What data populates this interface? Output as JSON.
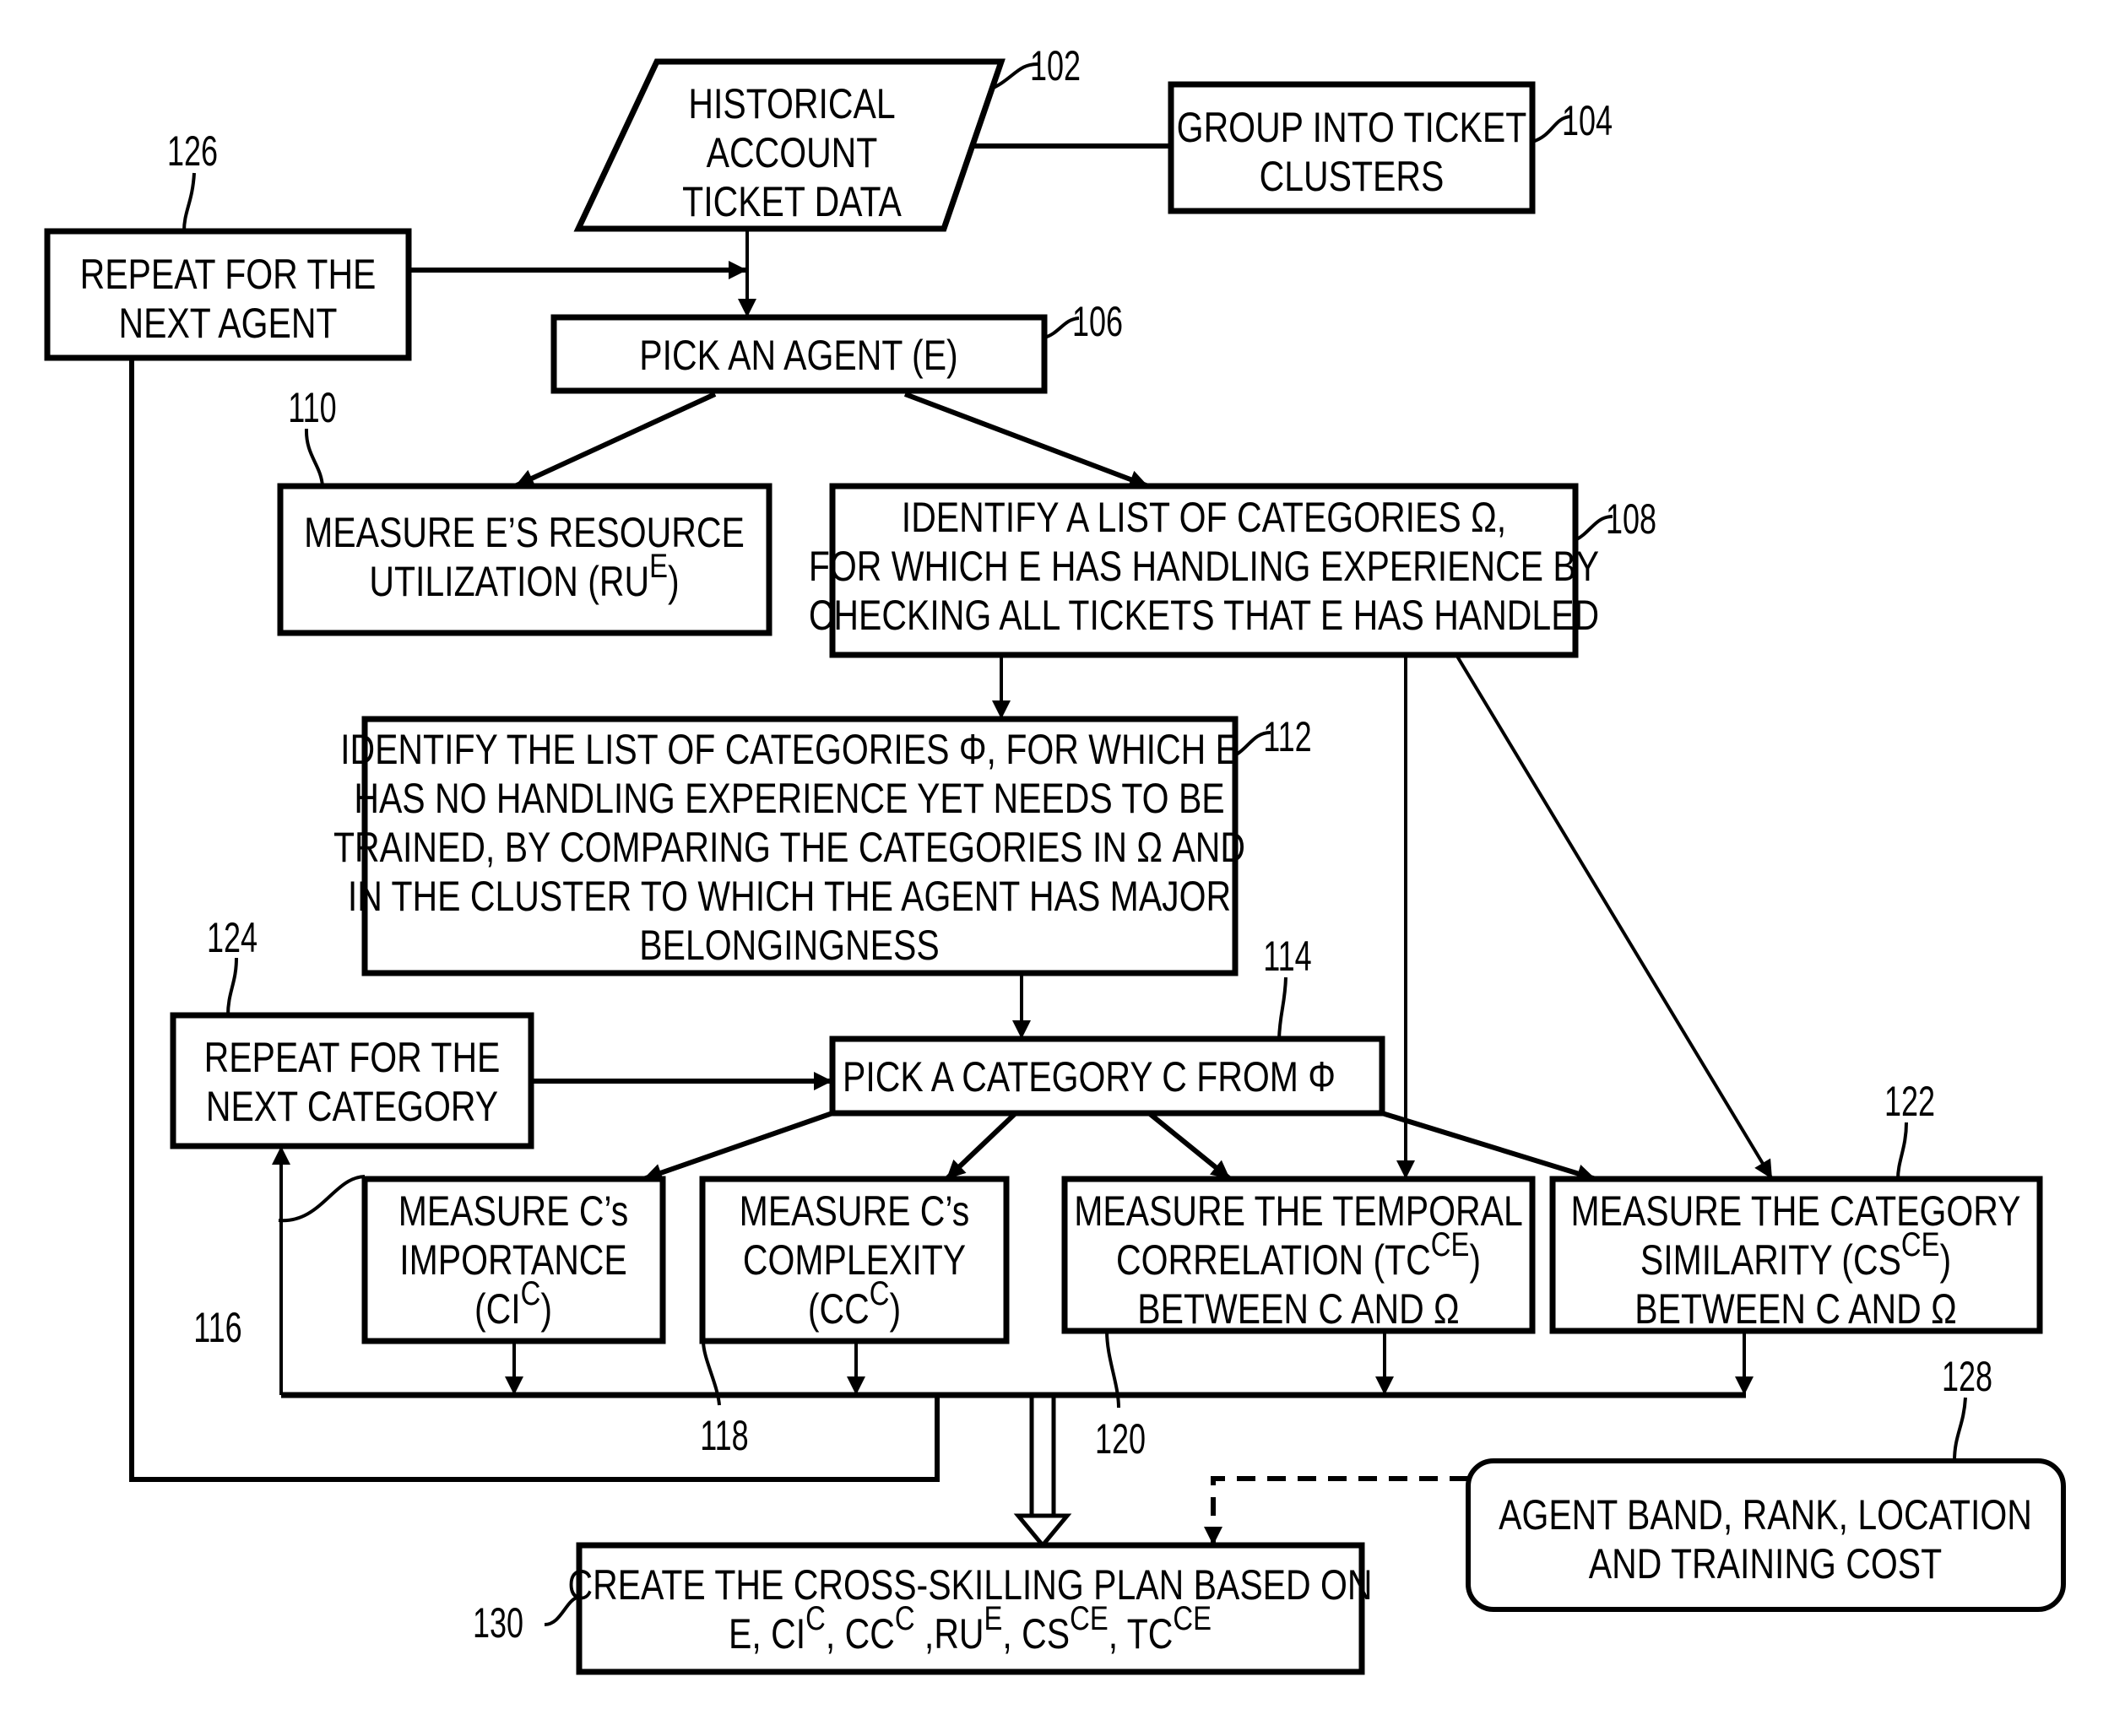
{
  "figure": {
    "type": "flowchart",
    "colors": {
      "stroke": "#000000",
      "background": "#ffffff"
    }
  },
  "nodes": {
    "n102": {
      "ref": "102",
      "shape": "parallelogram",
      "lines": [
        "HISTORICAL",
        "ACCOUNT",
        "TICKET DATA"
      ]
    },
    "n104": {
      "ref": "104",
      "shape": "rectangle",
      "lines": [
        "GROUP INTO TICKET",
        "CLUSTERS"
      ]
    },
    "n106": {
      "ref": "106",
      "shape": "rectangle",
      "lines": [
        "PICK AN AGENT (E)"
      ]
    },
    "n108": {
      "ref": "108",
      "shape": "rectangle",
      "lines": [
        "IDENTIFY A LIST OF CATEGORIES Ω,",
        "FOR WHICH E HAS HANDLING EXPERIENCE BY",
        "CHECKING ALL TICKETS THAT E HAS HANDLED"
      ]
    },
    "n110": {
      "ref": "110",
      "shape": "rectangle",
      "lines": [
        "MEASURE E’S RESOURCE",
        "UTILIZATION (RU|E|)"
      ]
    },
    "n112": {
      "ref": "112",
      "shape": "rectangle",
      "lines": [
        "IDENTIFY THE LIST OF CATEGORIES Φ, FOR WHICH E",
        "HAS NO HANDLING EXPERIENCE YET NEEDS TO BE",
        "TRAINED, BY COMPARING THE CATEGORIES IN Ω AND",
        "IN THE CLUSTER TO WHICH THE AGENT HAS MAJOR",
        "BELONGINGNESS"
      ]
    },
    "n114": {
      "ref": "114",
      "shape": "rectangle",
      "lines": [
        "PICK A CATEGORY C FROM Φ"
      ]
    },
    "n116": {
      "ref": "116",
      "shape": "rectangle",
      "lines": [
        "MEASURE C’s",
        "IMPORTANCE",
        "(CI|C|)"
      ]
    },
    "n118": {
      "ref": "118",
      "shape": "rectangle",
      "lines": [
        "MEASURE C’s",
        "COMPLEXITY",
        "(CC|C|)"
      ]
    },
    "n120": {
      "ref": "120",
      "shape": "rectangle",
      "lines": [
        "MEASURE THE TEMPORAL",
        "CORRELATION (TC|CE|)",
        "BETWEEN C AND Ω"
      ]
    },
    "n122": {
      "ref": "122",
      "shape": "rectangle",
      "lines": [
        "MEASURE THE CATEGORY",
        "SIMILARITY (CS|CE|)",
        "BETWEEN C AND Ω"
      ]
    },
    "n124": {
      "ref": "124",
      "shape": "rectangle",
      "lines": [
        "REPEAT FOR THE",
        "NEXT CATEGORY"
      ]
    },
    "n126": {
      "ref": "126",
      "shape": "rectangle",
      "lines": [
        "REPEAT FOR THE",
        "NEXT AGENT"
      ]
    },
    "n128": {
      "ref": "128",
      "shape": "rounded-rectangle",
      "lines": [
        "AGENT BAND, RANK, LOCATION",
        "AND TRAINING COST"
      ]
    },
    "n130": {
      "ref": "130",
      "shape": "rectangle",
      "lines": [
        "CREATE THE CROSS-SKILLING PLAN BASED ON",
        "E, CI|C|, CC|C| ,RU|E|, CS|CE|, TC|CE|"
      ]
    }
  },
  "edges": [
    {
      "from": "102",
      "to": "104",
      "style": "line"
    },
    {
      "from": "102",
      "to": "106",
      "style": "arrow"
    },
    {
      "from": "126",
      "to": "106",
      "style": "arrow"
    },
    {
      "from": "106",
      "to": "110",
      "style": "arrow"
    },
    {
      "from": "106",
      "to": "108",
      "style": "arrow"
    },
    {
      "from": "108",
      "to": "112",
      "style": "arrow"
    },
    {
      "from": "108",
      "to": "120",
      "style": "arrow"
    },
    {
      "from": "108",
      "to": "122",
      "style": "arrow"
    },
    {
      "from": "112",
      "to": "114",
      "style": "arrow"
    },
    {
      "from": "124",
      "to": "114",
      "style": "arrow"
    },
    {
      "from": "114",
      "to": "116",
      "style": "arrow"
    },
    {
      "from": "114",
      "to": "118",
      "style": "arrow"
    },
    {
      "from": "114",
      "to": "120",
      "style": "arrow"
    },
    {
      "from": "114",
      "to": "122",
      "style": "arrow"
    },
    {
      "from": "116",
      "to": "bus",
      "style": "arrow"
    },
    {
      "from": "118",
      "to": "bus",
      "style": "arrow"
    },
    {
      "from": "120",
      "to": "bus",
      "style": "arrow"
    },
    {
      "from": "122",
      "to": "bus",
      "style": "arrow"
    },
    {
      "from": "bus",
      "to": "124",
      "style": "arrow"
    },
    {
      "from": "bus",
      "to": "126",
      "style": "line"
    },
    {
      "from": "bus",
      "to": "130",
      "style": "hollow-double-arrow"
    },
    {
      "from": "128",
      "to": "130",
      "style": "dashed-arrow"
    }
  ]
}
